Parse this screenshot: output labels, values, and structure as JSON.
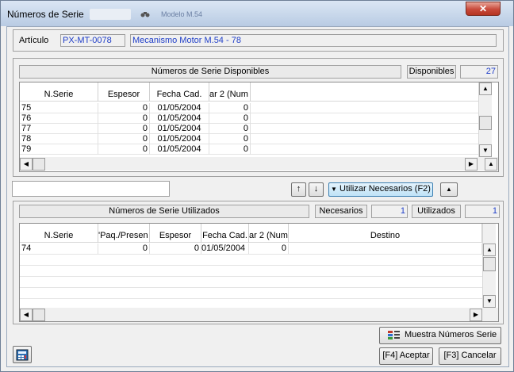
{
  "window": {
    "title": "Números de Serie",
    "bg_title_fragment": "Modelo M.54",
    "close_glyph": "✕"
  },
  "articulo": {
    "label": "Artículo",
    "code": "PX-MT-0078",
    "description": "Mecanismo Motor M.54 - 78"
  },
  "disponibles": {
    "header": "Números de Serie Disponibles",
    "count_label": "Disponibles",
    "count_value": "27",
    "columns": [
      "N.Serie",
      "Espesor",
      "Fecha Cad.",
      "ar 2 (Num"
    ],
    "rows": [
      {
        "serie": "75",
        "espesor": "0",
        "fecha": "01/05/2004",
        "num": "0"
      },
      {
        "serie": "76",
        "espesor": "0",
        "fecha": "01/05/2004",
        "num": "0"
      },
      {
        "serie": "77",
        "espesor": "0",
        "fecha": "01/05/2004",
        "num": "0"
      },
      {
        "serie": "78",
        "espesor": "0",
        "fecha": "01/05/2004",
        "num": "0"
      },
      {
        "serie": "79",
        "espesor": "0",
        "fecha": "01/05/2004",
        "num": "0"
      }
    ]
  },
  "controls": {
    "search_value": "",
    "up_glyph": "↑",
    "down_glyph": "↓",
    "utilizar_label": "Utilizar Necesarios (F2)",
    "utilizar_glyph": "▼",
    "collapse_glyph": "▲"
  },
  "utilizados": {
    "header": "Números de Serie Utilizados",
    "necesarios_label": "Necesarios",
    "necesarios_value": "1",
    "utilizados_label": "Utilizados",
    "utilizados_value": "1",
    "columns": [
      "N.Serie",
      "'Paq./Presen",
      "Espesor",
      "Fecha Cad.",
      "ar 2 (Num",
      "Destino"
    ],
    "rows": [
      {
        "serie": "74",
        "paq": "0",
        "espesor": "0",
        "fecha": "01/05/2004",
        "num": "0",
        "destino": ""
      }
    ]
  },
  "footer": {
    "muestra_label": "Muestra Números Serie",
    "aceptar_label": "[F4] Aceptar",
    "cancelar_label": "[F3] Cancelar"
  },
  "colors": {
    "accent_blue": "#1f3ec8",
    "title_bar": "#c6d6ea",
    "close_red": "#c8493a"
  }
}
